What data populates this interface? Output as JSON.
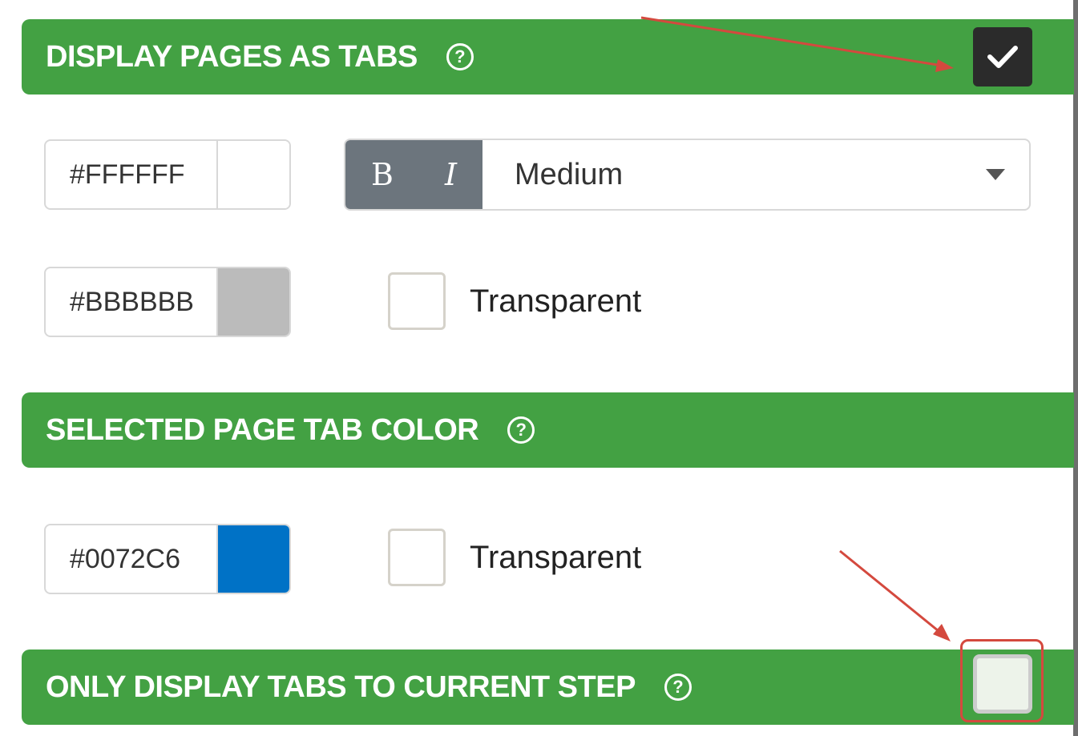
{
  "sections": {
    "display_tabs": {
      "title": "DISPLAY PAGES AS TABS",
      "help_icon": "?",
      "checked": true,
      "check_glyph": "✓"
    },
    "selected_tab_color": {
      "title": "SELECTED PAGE TAB COLOR",
      "help_icon": "?"
    },
    "only_current_step": {
      "title": "ONLY DISPLAY TABS TO CURRENT STEP",
      "help_icon": "?",
      "checked": false
    }
  },
  "tab_text": {
    "color_hex": "#FFFFFF",
    "swatch_color": "#FFFFFF",
    "bold_label": "B",
    "italic_label": "I",
    "font_size": "Medium"
  },
  "tab_background": {
    "color_hex": "#BBBBBB",
    "swatch_color": "#BBBBBB",
    "transparent_label": "Transparent",
    "transparent_checked": false
  },
  "selected_tab": {
    "color_hex": "#0072C6",
    "swatch_color": "#0072C6",
    "transparent_label": "Transparent",
    "transparent_checked": false
  },
  "colors": {
    "section_green": "#43A143",
    "annotation_red": "#D4493E"
  }
}
